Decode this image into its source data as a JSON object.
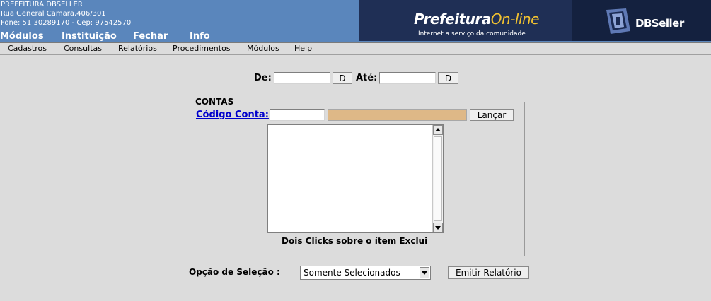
{
  "org": {
    "name": "PREFEITURA DBSELLER",
    "address": "Rua General Camara,406/301",
    "contact": "Fone: 51 30289170  -  Cep: 97542570"
  },
  "topnav": [
    "Módulos",
    "Instituição",
    "Fechar",
    "Info"
  ],
  "banner": {
    "title_a": "Prefeitura",
    "title_b": "On-line",
    "subtitle": "Internet a serviço da comunidade",
    "brand": "DBSeller"
  },
  "menubar": [
    "Cadastros",
    "Consultas",
    "Relatórios",
    "Procedimentos",
    "Módulos",
    "Help"
  ],
  "period": {
    "from_label": "De:",
    "from_value": "",
    "from_button": "D",
    "to_label": "Até:",
    "to_value": "",
    "to_button": "D"
  },
  "contas": {
    "legend": "CONTAS",
    "code_label": "Código Conta:",
    "code_value": "",
    "description_value": "",
    "launch_button": "Lançar",
    "list_items": [],
    "hint": "Dois Clicks sobre o ítem Exclui"
  },
  "selection": {
    "label": "Opção de Seleção :",
    "selected": "Somente Selecionados"
  },
  "report_button": "Emitir Relatório",
  "colors": {
    "header_bg": "#5a86bc",
    "banner_bg": "#1f2f55",
    "description_bg": "#deb887",
    "link": "#0000cc",
    "page_bg": "#dcdcdc"
  }
}
